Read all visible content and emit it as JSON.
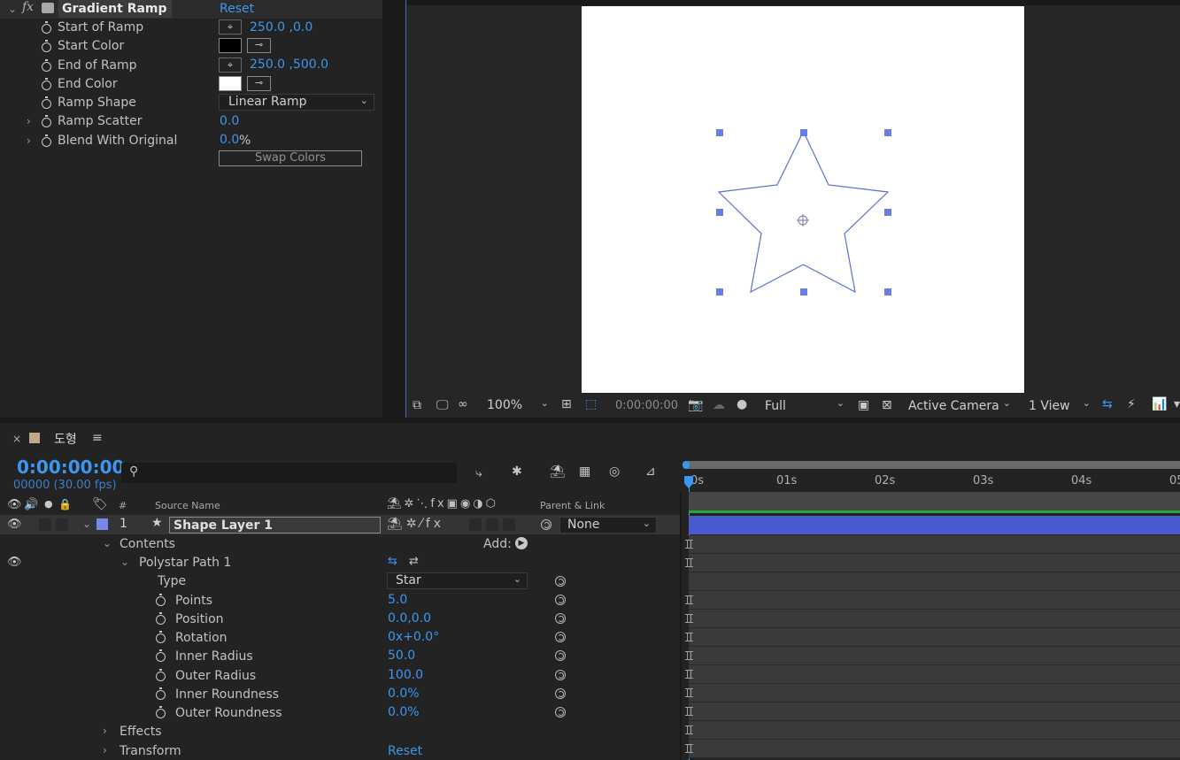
{
  "effect_controls": {
    "effect_name": "Gradient Ramp",
    "reset_label": "Reset",
    "fx_label": "fx",
    "properties": [
      {
        "label": "Start of Ramp",
        "value": "250.0 ,0.0"
      },
      {
        "label": "Start Color"
      },
      {
        "label": "End of Ramp",
        "value": "250.0 ,500.0"
      },
      {
        "label": "End Color"
      },
      {
        "label": "Ramp Shape",
        "value": "Linear Ramp"
      },
      {
        "label": "Ramp Scatter",
        "value": "0.0"
      },
      {
        "label": "Blend With Original",
        "value": "0.0",
        "unit": "%"
      }
    ],
    "swap_colors_label": "Swap Colors"
  },
  "viewer": {
    "zoom": "100%",
    "timecode": "0:00:00:00",
    "resolution": "Full",
    "camera": "Active Camera",
    "view_layout": "1 View"
  },
  "timeline": {
    "comp_name": "도형",
    "timecode": "0:00:00:00",
    "frame_info": "00000 (30.00 fps)",
    "col_hash": "#",
    "col_source": "Source Name",
    "col_parent": "Parent & Link",
    "ruler": [
      "0s",
      "01s",
      "02s",
      "03s",
      "04s",
      "05"
    ],
    "layer": {
      "index": "1",
      "name": "Shape Layer 1",
      "parent": "None"
    },
    "contents_label": "Contents",
    "add_label": "Add:",
    "polystar_label": "Polystar Path 1",
    "props": [
      {
        "label": "Type",
        "value": "Star"
      },
      {
        "label": "Points",
        "value": "5.0"
      },
      {
        "label": "Position",
        "value": "0.0,0.0"
      },
      {
        "label": "Rotation",
        "value": "0x+0.0°"
      },
      {
        "label": "Inner Radius",
        "value": "50.0"
      },
      {
        "label": "Outer Radius",
        "value": "100.0"
      },
      {
        "label": "Inner Roundness",
        "value": "0.0%"
      },
      {
        "label": "Outer Roundness",
        "value": "0.0%"
      }
    ],
    "effects_label": "Effects",
    "transform_label": "Transform",
    "transform_reset": "Reset"
  },
  "colors": {
    "accent": "#3b97ef",
    "panel": "#232323",
    "layer_bar": "#4a5bd0",
    "star_stroke": "#5a6fd0"
  }
}
